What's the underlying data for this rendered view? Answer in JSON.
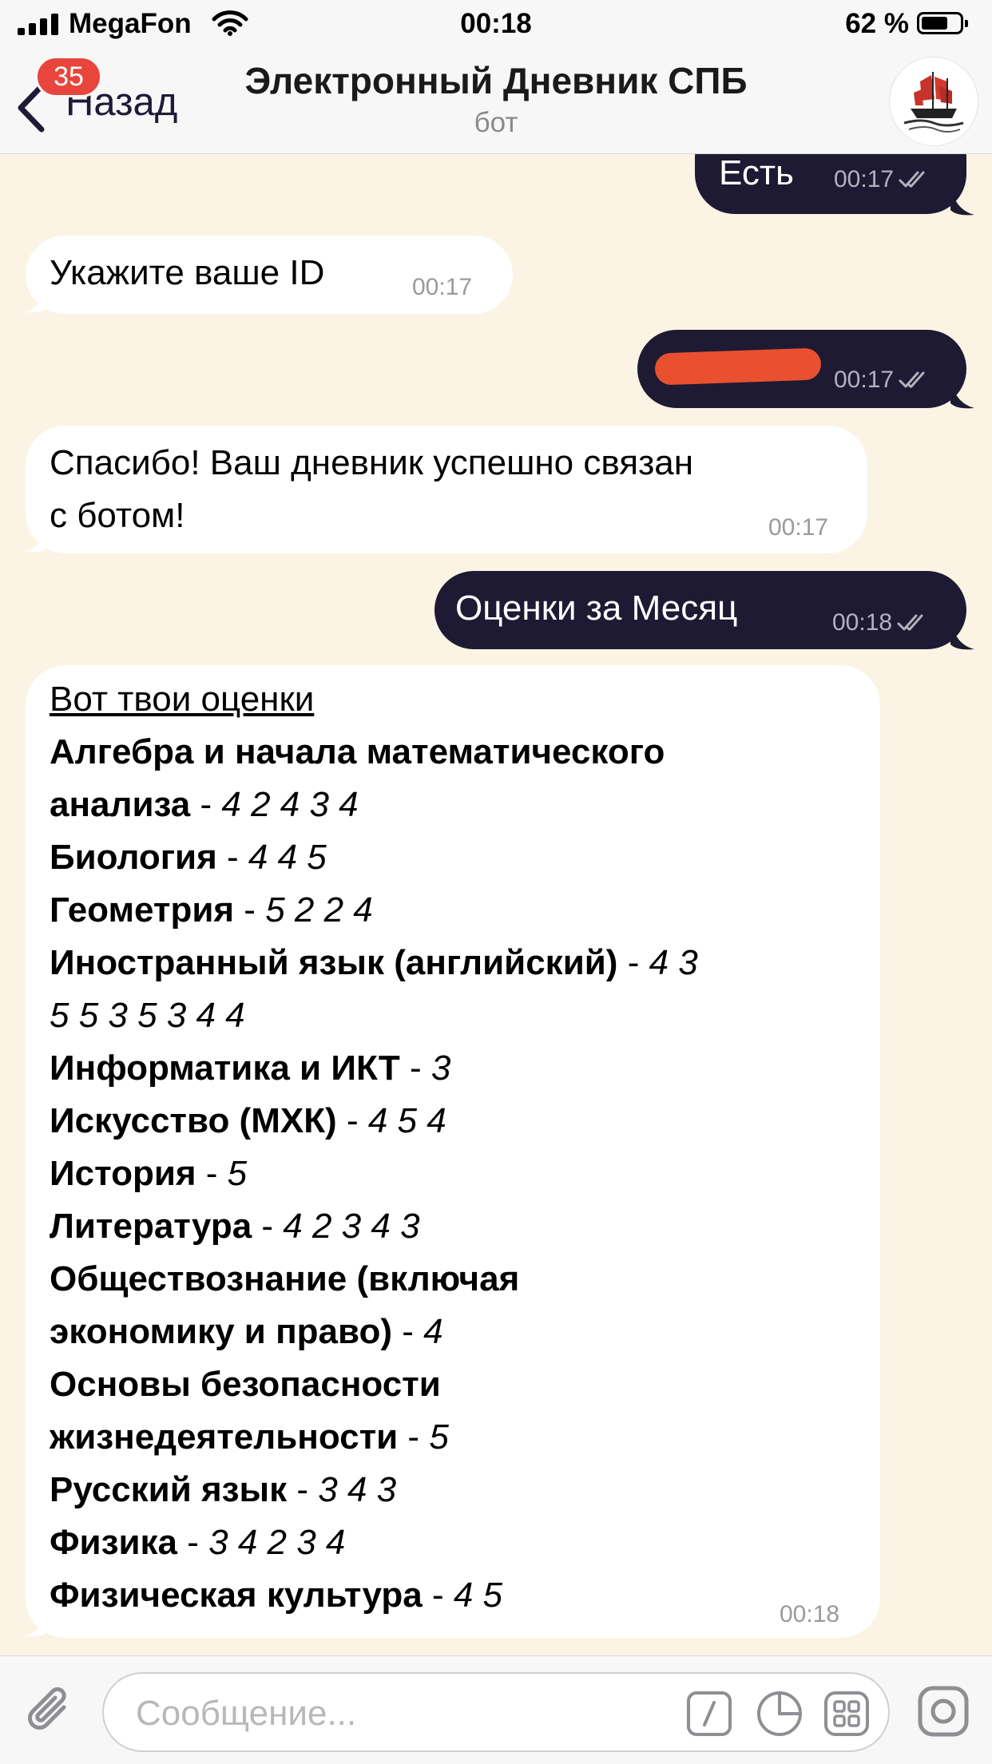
{
  "status_bar": {
    "carrier": "MegaFon",
    "time": "00:18",
    "battery_percent": "62 %"
  },
  "nav": {
    "back_label": "Назад",
    "unread_badge": "35",
    "title": "Электронный Дневник СПБ",
    "subtitle": "бот"
  },
  "messages": [
    {
      "dir": "out",
      "text": "Есть",
      "time": "00:17"
    },
    {
      "dir": "in",
      "text": "Укажите ваше ID",
      "time": "00:17"
    },
    {
      "dir": "out",
      "text": "",
      "time": "00:17",
      "redacted": true
    },
    {
      "dir": "in",
      "line1": "Спасибо! Ваш дневник успешно связан",
      "line2": "с ботом!",
      "time": "00:17"
    },
    {
      "dir": "out",
      "text": "Оценки за Месяц",
      "time": "00:18"
    }
  ],
  "grades": {
    "header": "Вот твои оценки",
    "time": "00:18",
    "lines": [
      {
        "subject": "Алгебра и начала математического",
        "dash": "",
        "marks": ""
      },
      {
        "subject": "анализа",
        "dash": " - ",
        "marks": "4 2 4 3 4"
      },
      {
        "subject": "Биология",
        "dash": " - ",
        "marks": "4 4 5"
      },
      {
        "subject": "Геометрия",
        "dash": " - ",
        "marks": "5 2 2 4"
      },
      {
        "subject": "Иностранный язык (английский)",
        "dash": " - ",
        "marks": "4 3"
      },
      {
        "subject": "",
        "dash": "",
        "marks": "5 5 3 5 3 4 4"
      },
      {
        "subject": "Информатика и ИКТ",
        "dash": " - ",
        "marks": "3"
      },
      {
        "subject": "Искусство (МХК)",
        "dash": " - ",
        "marks": "4 5 4"
      },
      {
        "subject": "История",
        "dash": " - ",
        "marks": "5"
      },
      {
        "subject": "Литература",
        "dash": " - ",
        "marks": "4 2 3 4 3"
      },
      {
        "subject": "Обществознание (включая",
        "dash": "",
        "marks": ""
      },
      {
        "subject": "экономику и право)",
        "dash": " - ",
        "marks": "4"
      },
      {
        "subject": "Основы безопасности",
        "dash": "",
        "marks": ""
      },
      {
        "subject": "жизнедеятельности",
        "dash": " - ",
        "marks": "5"
      },
      {
        "subject": "Русский язык",
        "dash": " - ",
        "marks": "3 4 3"
      },
      {
        "subject": "Физика",
        "dash": " - ",
        "marks": "3 4 2 3 4"
      },
      {
        "subject": "Физическая культура",
        "dash": " - ",
        "marks": "4 5"
      }
    ]
  },
  "input": {
    "placeholder": "Сообщение..."
  },
  "colors": {
    "chat_background": "#fbf4e4",
    "outgoing_bubble": "#1e1a33",
    "incoming_bubble": "#ffffff",
    "badge": "#e8453c",
    "redaction": "#e8502f"
  },
  "icons": [
    "signal-icon",
    "wifi-icon",
    "battery-icon",
    "back-chevron-icon",
    "bot-avatar-ship-icon",
    "read-checkmarks-icon",
    "attach-paperclip-icon",
    "command-slash-icon",
    "sticker-icon",
    "bot-keyboard-icon",
    "camera-icon"
  ]
}
